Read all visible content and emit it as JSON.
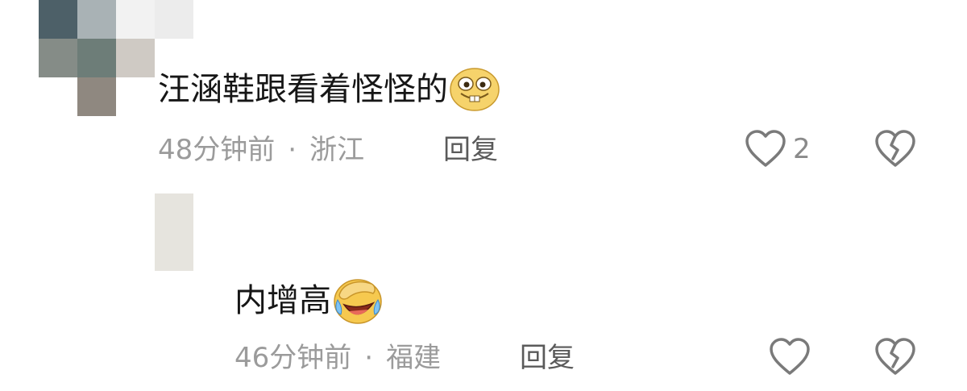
{
  "comments": [
    {
      "text": "汪涵鞋跟看着怪怪的",
      "emoji": "grinning-buck-teeth-emoji",
      "time": "48分钟前",
      "separator": "·",
      "location": "浙江",
      "reply_label": "回复",
      "like_count": "2"
    },
    {
      "text": "内增高",
      "emoji": "facepalm-laughing-emoji",
      "time": "46分钟前",
      "separator": "·",
      "location": "福建",
      "reply_label": "回复"
    }
  ],
  "colors": {
    "text": "#161616",
    "meta": "#9b9b9b",
    "reply": "#5a5a5a",
    "icon": "#7a7a7a",
    "background": "#ffffff"
  }
}
